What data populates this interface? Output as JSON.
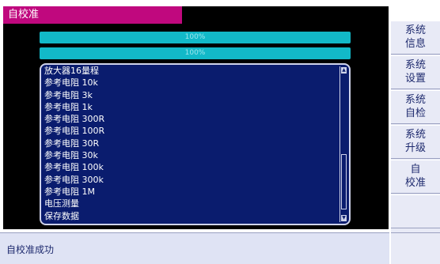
{
  "window": {
    "title": "自校准"
  },
  "progress": [
    {
      "label": "100%",
      "value": 1.0
    },
    {
      "label": "100%",
      "value": 1.0
    }
  ],
  "calibration_list": {
    "items": [
      "放大器16量程",
      "参考电阻 10k",
      "参考电阻 3k",
      "参考电阻 1k",
      "参考电阻 300R",
      "参考电阻 100R",
      "参考电阻 30R",
      "参考电阻 30k",
      "参考电阻 100k",
      "参考电阻 300k",
      "参考电阻 1M",
      "电压测量",
      "保存数据"
    ],
    "scroll_up_icon": "up-arrow-icon",
    "scroll_down_icon": "down-arrow-icon"
  },
  "sidebar": {
    "buttons": [
      {
        "line1": "系统",
        "line2": "信息"
      },
      {
        "line1": "系统",
        "line2": "设置"
      },
      {
        "line1": "系统",
        "line2": "自检"
      },
      {
        "line1": "系统",
        "line2": "升级"
      },
      {
        "line1": "自",
        "line2": "校准"
      }
    ]
  },
  "status": {
    "message": "自校准成功"
  },
  "colors": {
    "title_bar": "#c0087e",
    "progress_fill": "#12b9c8",
    "list_bg": "#0a1c6e",
    "panel_bg": "#000000",
    "button_bg": "#e8eaf6"
  }
}
